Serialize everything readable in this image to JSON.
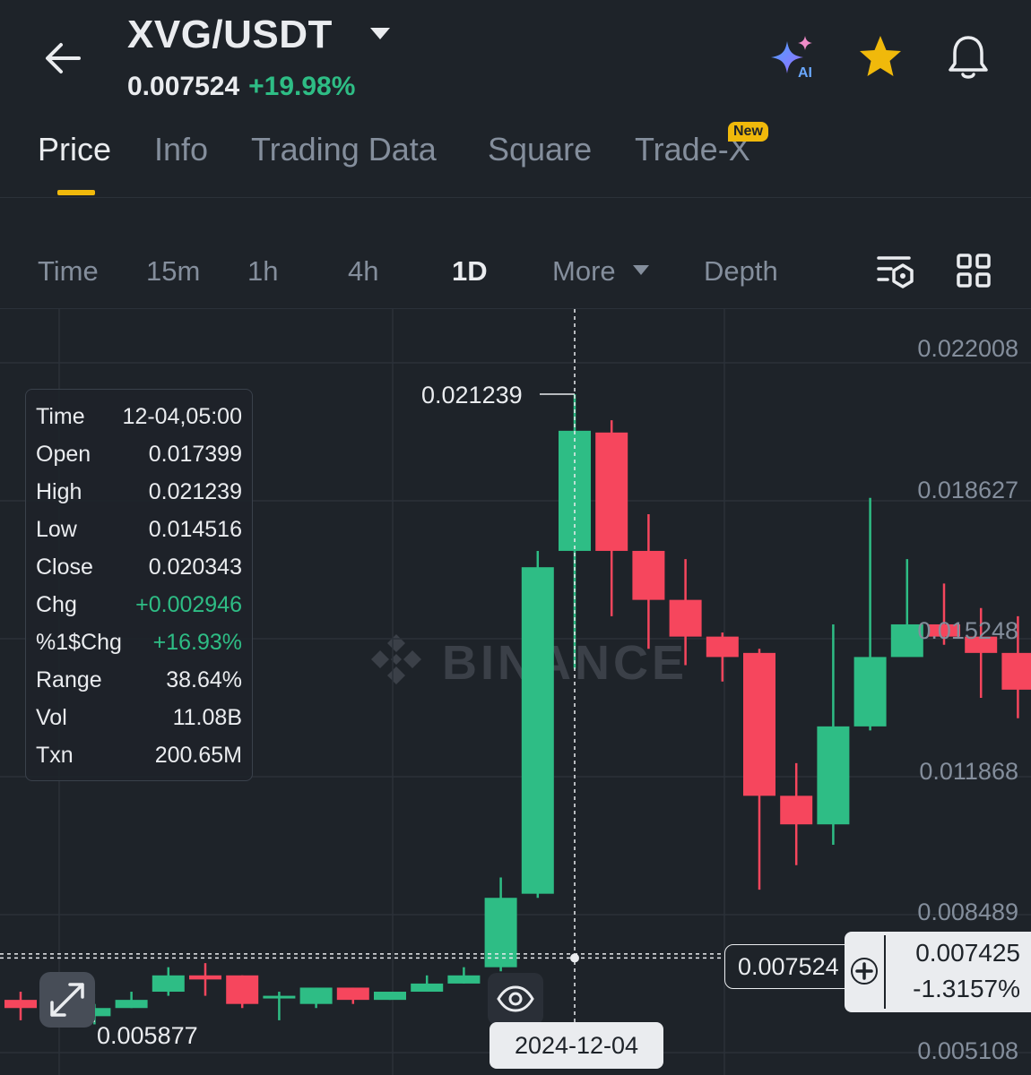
{
  "header": {
    "pair": "XVG/USDT",
    "price": "0.007524",
    "change_pct": "+19.98%",
    "icons": [
      "back-arrow-icon",
      "caret-down-icon",
      "ai-sparkle-icon",
      "star-icon",
      "bell-icon"
    ],
    "ai_label": "AI"
  },
  "tabs": [
    {
      "label": "Price",
      "active": true
    },
    {
      "label": "Info"
    },
    {
      "label": "Trading Data"
    },
    {
      "label": "Square"
    },
    {
      "label": "Trade-X",
      "badge": "New"
    }
  ],
  "intervals": [
    {
      "label": "Time"
    },
    {
      "label": "15m"
    },
    {
      "label": "1h"
    },
    {
      "label": "4h"
    },
    {
      "label": "1D",
      "active": true
    },
    {
      "label": "More"
    },
    {
      "label": "Depth"
    }
  ],
  "tooltip": [
    {
      "k": "Time",
      "v": "12-04,05:00"
    },
    {
      "k": "Open",
      "v": "0.017399"
    },
    {
      "k": "High",
      "v": "0.021239"
    },
    {
      "k": "Low",
      "v": "0.014516"
    },
    {
      "k": "Close",
      "v": "0.020343"
    },
    {
      "k": "Chg",
      "v": "+0.002946"
    },
    {
      "k": "%1$Chg",
      "v": "+16.93%"
    },
    {
      "k": "Range",
      "v": "38.64%"
    },
    {
      "k": "Vol",
      "v": "11.08B"
    },
    {
      "k": "Txn",
      "v": "200.65M"
    }
  ],
  "watermark": "BINANCE",
  "chart_labels": {
    "high": "0.021239",
    "low": "0.005877",
    "date": "2024-12-04",
    "current_price": "0.007524",
    "cursor_price": "0.007425",
    "cursor_pct": "-1.3157%"
  },
  "colors": {
    "up": "#2ebd85",
    "down": "#f6465d",
    "accent": "#f0b90b",
    "bg": "#1e2329"
  },
  "chart_data": {
    "type": "candlestick",
    "y_axis_ticks": [
      "0.022008",
      "0.018627",
      "0.015248",
      "0.011868",
      "0.008489",
      "0.005108"
    ],
    "ylim": [
      0.004,
      0.0236
    ],
    "candles": [
      {
        "o": 0.0064,
        "h": 0.0066,
        "l": 0.0059,
        "c": 0.0062
      },
      {
        "o": 0.0061,
        "h": 0.0063,
        "l": 0.0059,
        "c": 0.006
      },
      {
        "o": 0.006,
        "h": 0.0063,
        "l": 0.0058,
        "c": 0.0062
      },
      {
        "o": 0.0062,
        "h": 0.0066,
        "l": 0.0062,
        "c": 0.0064
      },
      {
        "o": 0.0066,
        "h": 0.0072,
        "l": 0.0065,
        "c": 0.007
      },
      {
        "o": 0.007,
        "h": 0.0073,
        "l": 0.0065,
        "c": 0.0069
      },
      {
        "o": 0.007,
        "h": 0.007,
        "l": 0.0062,
        "c": 0.0063
      },
      {
        "o": 0.0065,
        "h": 0.0066,
        "l": 0.0059,
        "c": 0.0065
      },
      {
        "o": 0.0063,
        "h": 0.0067,
        "l": 0.0062,
        "c": 0.0067
      },
      {
        "o": 0.0067,
        "h": 0.0067,
        "l": 0.0063,
        "c": 0.0064
      },
      {
        "o": 0.0064,
        "h": 0.0066,
        "l": 0.0064,
        "c": 0.0066
      },
      {
        "o": 0.0066,
        "h": 0.007,
        "l": 0.0066,
        "c": 0.0068
      },
      {
        "o": 0.0068,
        "h": 0.0072,
        "l": 0.0068,
        "c": 0.007
      },
      {
        "o": 0.0072,
        "h": 0.0094,
        "l": 0.0071,
        "c": 0.0089
      },
      {
        "o": 0.009,
        "h": 0.0174,
        "l": 0.0089,
        "c": 0.017
      },
      {
        "o": 0.0174,
        "h": 0.02124,
        "l": 0.014516,
        "c": 0.020343
      },
      {
        "o": 0.0203,
        "h": 0.0206,
        "l": 0.0158,
        "c": 0.0174
      },
      {
        "o": 0.0174,
        "h": 0.0183,
        "l": 0.015,
        "c": 0.0162
      },
      {
        "o": 0.0162,
        "h": 0.0172,
        "l": 0.0146,
        "c": 0.0153
      },
      {
        "o": 0.0153,
        "h": 0.0154,
        "l": 0.0142,
        "c": 0.0148
      },
      {
        "o": 0.0149,
        "h": 0.015,
        "l": 0.0091,
        "c": 0.0114
      },
      {
        "o": 0.0114,
        "h": 0.0122,
        "l": 0.0097,
        "c": 0.0107
      },
      {
        "o": 0.0107,
        "h": 0.0156,
        "l": 0.0102,
        "c": 0.0131
      },
      {
        "o": 0.0131,
        "h": 0.0187,
        "l": 0.013,
        "c": 0.0148
      },
      {
        "o": 0.0148,
        "h": 0.0172,
        "l": 0.0152,
        "c": 0.0156
      },
      {
        "o": 0.0156,
        "h": 0.0166,
        "l": 0.0151,
        "c": 0.0153
      },
      {
        "o": 0.0153,
        "h": 0.016,
        "l": 0.0138,
        "c": 0.0149
      },
      {
        "o": 0.0149,
        "h": 0.0158,
        "l": 0.0133,
        "c": 0.014
      }
    ]
  }
}
